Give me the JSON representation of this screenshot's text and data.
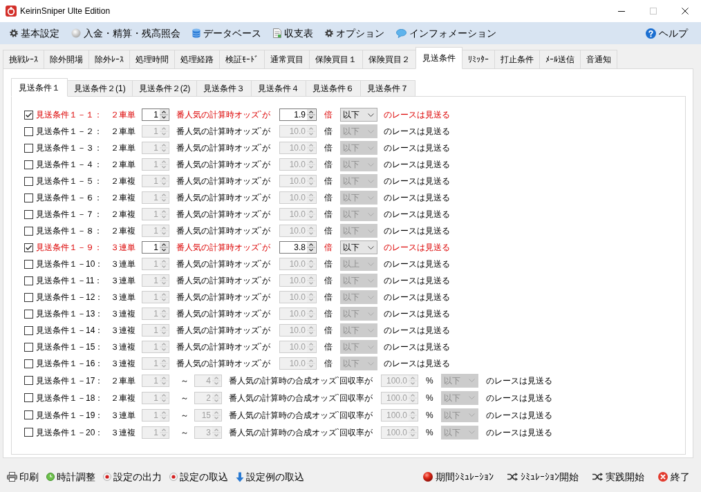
{
  "window": {
    "title": "KeirinSniper Ulte Edition"
  },
  "menu": [
    {
      "label": "基本設定"
    },
    {
      "label": "入金・精算・残高照会"
    },
    {
      "label": "データベース"
    },
    {
      "label": "収支表"
    },
    {
      "label": "オプション"
    },
    {
      "label": "インフォメーション"
    }
  ],
  "help": {
    "label": "ヘルプ"
  },
  "tabs": [
    {
      "label": "挑戦ﾚｰｽ",
      "selected": false
    },
    {
      "label": "除外開場",
      "selected": false
    },
    {
      "label": "除外ﾚｰｽ",
      "selected": false
    },
    {
      "label": "処理時間",
      "selected": false
    },
    {
      "label": "処理経路",
      "selected": false
    },
    {
      "label": "検証ﾓｰﾄﾞ",
      "selected": false
    },
    {
      "label": "通常買目",
      "selected": false
    },
    {
      "label": "保険買目１",
      "selected": false
    },
    {
      "label": "保険買目２",
      "selected": false
    },
    {
      "label": "見送条件",
      "selected": true
    },
    {
      "label": "ﾘﾐｯﾀｰ",
      "selected": false
    },
    {
      "label": "打止条件",
      "selected": false
    },
    {
      "label": "ﾒｰﾙ送信",
      "selected": false
    },
    {
      "label": "音通知",
      "selected": false
    }
  ],
  "subtabs": [
    {
      "label": "見送条件１",
      "selected": true
    },
    {
      "label": "見送条件２(1)",
      "selected": false
    },
    {
      "label": "見送条件２(2)",
      "selected": false
    },
    {
      "label": "見送条件３",
      "selected": false
    },
    {
      "label": "見送条件４",
      "selected": false
    },
    {
      "label": "見送条件６",
      "selected": false
    },
    {
      "label": "見送条件７",
      "selected": false
    }
  ],
  "conditions": [
    {
      "kind": "single",
      "checked": true,
      "label": "見送条件１－１：",
      "bet_type": "２車単",
      "rank": "1",
      "text": "番人気の計算時オッズ`が",
      "threshold": "1.9",
      "unit": "倍",
      "comparison": "以下",
      "tail": "のレースは見送る"
    },
    {
      "kind": "single",
      "checked": false,
      "label": "見送条件１－２：",
      "bet_type": "２車単",
      "rank": "1",
      "text": "番人気の計算時オッズ`が",
      "threshold": "10.0",
      "unit": "倍",
      "comparison": "以下",
      "tail": "のレースは見送る"
    },
    {
      "kind": "single",
      "checked": false,
      "label": "見送条件１－３：",
      "bet_type": "２車単",
      "rank": "1",
      "text": "番人気の計算時オッズ`が",
      "threshold": "10.0",
      "unit": "倍",
      "comparison": "以下",
      "tail": "のレースは見送る"
    },
    {
      "kind": "single",
      "checked": false,
      "label": "見送条件１－４：",
      "bet_type": "２車単",
      "rank": "1",
      "text": "番人気の計算時オッズ`が",
      "threshold": "10.0",
      "unit": "倍",
      "comparison": "以下",
      "tail": "のレースは見送る"
    },
    {
      "kind": "single",
      "checked": false,
      "label": "見送条件１－５：",
      "bet_type": "２車複",
      "rank": "1",
      "text": "番人気の計算時オッズ`が",
      "threshold": "10.0",
      "unit": "倍",
      "comparison": "以下",
      "tail": "のレースは見送る"
    },
    {
      "kind": "single",
      "checked": false,
      "label": "見送条件１－６：",
      "bet_type": "２車複",
      "rank": "1",
      "text": "番人気の計算時オッズ`が",
      "threshold": "10.0",
      "unit": "倍",
      "comparison": "以下",
      "tail": "のレースは見送る"
    },
    {
      "kind": "single",
      "checked": false,
      "label": "見送条件１－７：",
      "bet_type": "２車複",
      "rank": "1",
      "text": "番人気の計算時オッズ`が",
      "threshold": "10.0",
      "unit": "倍",
      "comparison": "以下",
      "tail": "のレースは見送る"
    },
    {
      "kind": "single",
      "checked": false,
      "label": "見送条件１－８：",
      "bet_type": "２車複",
      "rank": "1",
      "text": "番人気の計算時オッズ`が",
      "threshold": "10.0",
      "unit": "倍",
      "comparison": "以下",
      "tail": "のレースは見送る"
    },
    {
      "kind": "single",
      "checked": true,
      "label": "見送条件１－９：",
      "bet_type": "３連単",
      "rank": "1",
      "text": "番人気の計算時オッズ`が",
      "threshold": "3.8",
      "unit": "倍",
      "comparison": "以下",
      "tail": "のレースは見送る"
    },
    {
      "kind": "single",
      "checked": false,
      "label": "見送条件１－10：",
      "bet_type": "３連単",
      "rank": "1",
      "text": "番人気の計算時オッズ`が",
      "threshold": "10.0",
      "unit": "倍",
      "comparison": "以上",
      "tail": "のレースは見送る"
    },
    {
      "kind": "single",
      "checked": false,
      "label": "見送条件１－11：",
      "bet_type": "３連単",
      "rank": "1",
      "text": "番人気の計算時オッズ`が",
      "threshold": "10.0",
      "unit": "倍",
      "comparison": "以下",
      "tail": "のレースは見送る"
    },
    {
      "kind": "single",
      "checked": false,
      "label": "見送条件１－12：",
      "bet_type": "３連単",
      "rank": "1",
      "text": "番人気の計算時オッズ`が",
      "threshold": "10.0",
      "unit": "倍",
      "comparison": "以下",
      "tail": "のレースは見送る"
    },
    {
      "kind": "single",
      "checked": false,
      "label": "見送条件１－13：",
      "bet_type": "３連複",
      "rank": "1",
      "text": "番人気の計算時オッズ`が",
      "threshold": "10.0",
      "unit": "倍",
      "comparison": "以下",
      "tail": "のレースは見送る"
    },
    {
      "kind": "single",
      "checked": false,
      "label": "見送条件１－14：",
      "bet_type": "３連複",
      "rank": "1",
      "text": "番人気の計算時オッズ`が",
      "threshold": "10.0",
      "unit": "倍",
      "comparison": "以下",
      "tail": "のレースは見送る"
    },
    {
      "kind": "single",
      "checked": false,
      "label": "見送条件１－15：",
      "bet_type": "３連複",
      "rank": "1",
      "text": "番人気の計算時オッズ`が",
      "threshold": "10.0",
      "unit": "倍",
      "comparison": "以下",
      "tail": "のレースは見送る"
    },
    {
      "kind": "single",
      "checked": false,
      "label": "見送条件１－16：",
      "bet_type": "３連複",
      "rank": "1",
      "text": "番人気の計算時オッズ`が",
      "threshold": "10.0",
      "unit": "倍",
      "comparison": "以下",
      "tail": "のレースは見送る"
    },
    {
      "kind": "range",
      "checked": false,
      "label": "見送条件１－17：",
      "bet_type": "２車単",
      "rank_from": "1",
      "separator": "～",
      "rank_to": "4",
      "text": "番人気の計算時の合成オッズ`回収率が",
      "threshold": "100.0",
      "unit": "%",
      "comparison": "以下",
      "tail": "のレースは見送る"
    },
    {
      "kind": "range",
      "checked": false,
      "label": "見送条件１－18：",
      "bet_type": "２車複",
      "rank_from": "1",
      "separator": "～",
      "rank_to": "2",
      "text": "番人気の計算時の合成オッズ`回収率が",
      "threshold": "100.0",
      "unit": "%",
      "comparison": "以下",
      "tail": "のレースは見送る"
    },
    {
      "kind": "range",
      "checked": false,
      "label": "見送条件１－19：",
      "bet_type": "３連単",
      "rank_from": "1",
      "separator": "～",
      "rank_to": "15",
      "text": "番人気の計算時の合成オッズ`回収率が",
      "threshold": "100.0",
      "unit": "%",
      "comparison": "以下",
      "tail": "のレースは見送る"
    },
    {
      "kind": "range",
      "checked": false,
      "label": "見送条件１－20：",
      "bet_type": "３連複",
      "rank_from": "1",
      "separator": "～",
      "rank_to": "3",
      "text": "番人気の計算時の合成オッズ`回収率が",
      "threshold": "100.0",
      "unit": "%",
      "comparison": "以下",
      "tail": "のレースは見送る"
    }
  ],
  "toolbar_left": [
    {
      "label": "印刷"
    },
    {
      "label": "時計調整"
    },
    {
      "label": "設定の出力"
    },
    {
      "label": "設定の取込"
    },
    {
      "label": "設定例の取込"
    }
  ],
  "toolbar_right": [
    {
      "label": "期間ｼﾐｭﾚｰｼｮﾝ"
    },
    {
      "label": "ｼﾐｭﾚｰｼｮﾝ開始"
    },
    {
      "label": "実践開始"
    },
    {
      "label": "終了"
    }
  ]
}
